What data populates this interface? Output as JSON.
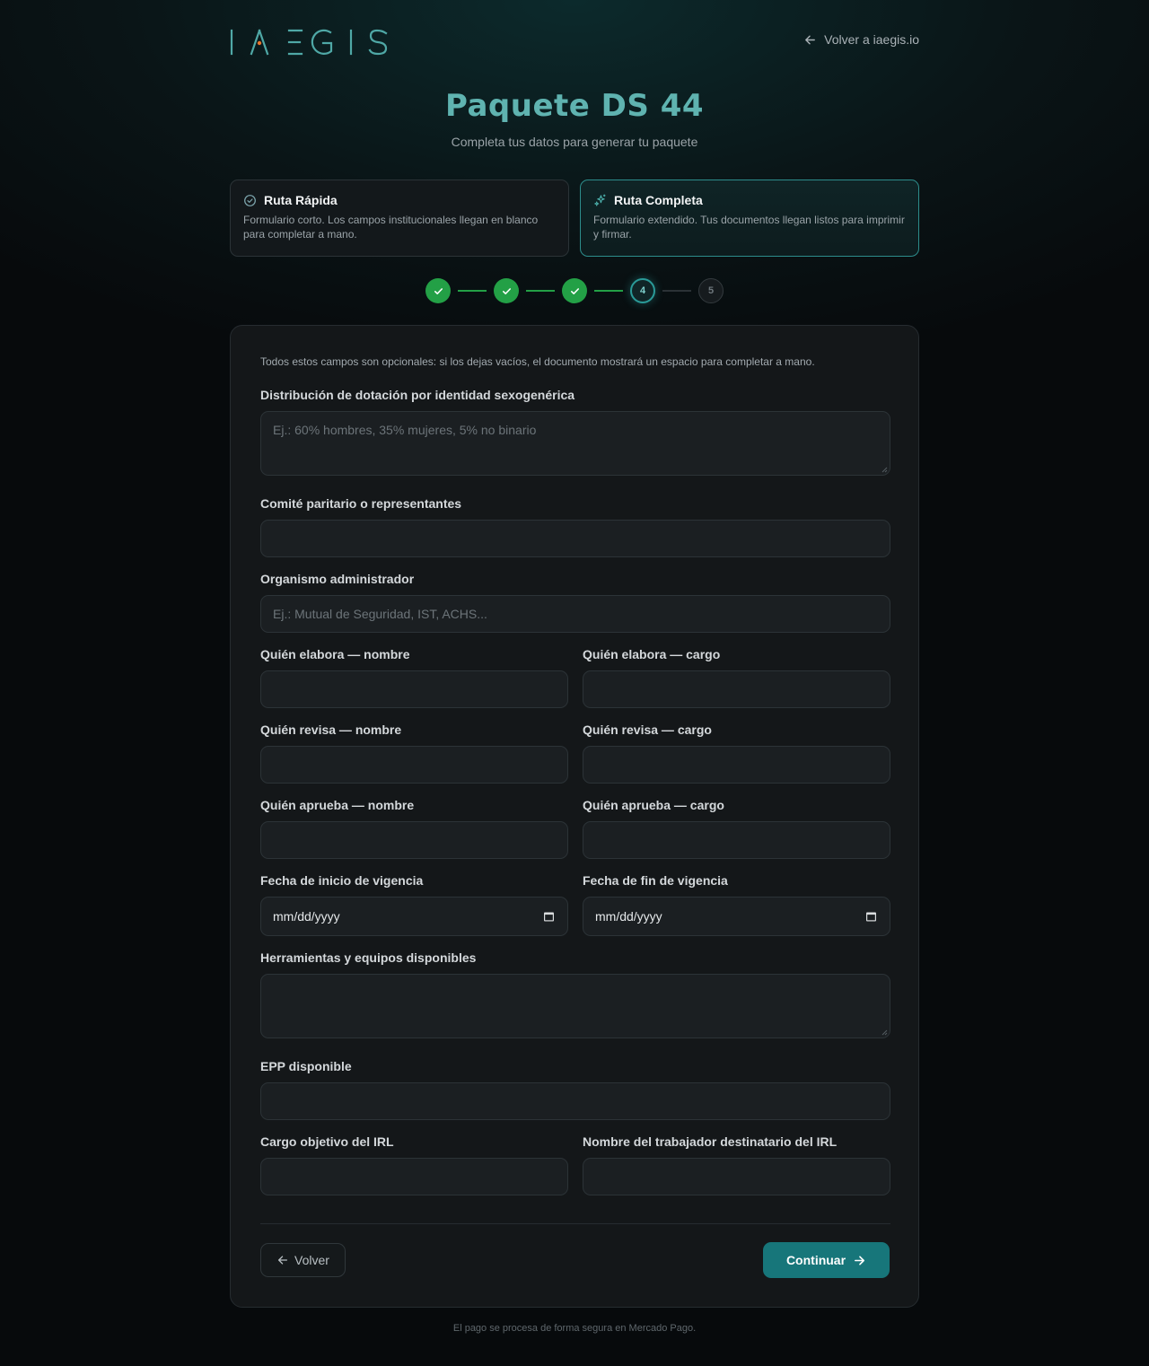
{
  "brand": {
    "logo_text": "IAEGIS",
    "accent_color": "#5fb3b0",
    "logo_dot_color": "#e8742a"
  },
  "header": {
    "back_link": "Volver a iaegis.io"
  },
  "page": {
    "title": "Paquete DS 44",
    "subtitle": "Completa tus datos para generar tu paquete"
  },
  "routes": [
    {
      "icon": "check-circle-icon",
      "title": "Ruta Rápida",
      "description": "Formulario corto. Los campos institucionales llegan en blanco para completar a mano.",
      "selected": false
    },
    {
      "icon": "sparkles-icon",
      "title": "Ruta Completa",
      "description": "Formulario extendido. Tus documentos llegan listos para imprimir y firmar.",
      "selected": true
    }
  ],
  "stepper": {
    "current": 4,
    "steps": [
      {
        "label": "1",
        "status": "done"
      },
      {
        "label": "2",
        "status": "done"
      },
      {
        "label": "3",
        "status": "done"
      },
      {
        "label": "4",
        "status": "current"
      },
      {
        "label": "5",
        "status": "pending"
      }
    ],
    "done_color": "#23a046"
  },
  "form": {
    "note": "Todos estos campos son opcionales: si los dejas vacíos, el documento mostrará un espacio para completar a mano.",
    "fields": {
      "distribucion": {
        "label": "Distribución de dotación por identidad sexogenérica",
        "placeholder": "Ej.: 60% hombres, 35% mujeres, 5% no binario",
        "value": ""
      },
      "comite": {
        "label": "Comité paritario o representantes",
        "placeholder": "",
        "value": ""
      },
      "organismo": {
        "label": "Organismo administrador",
        "placeholder": "Ej.: Mutual de Seguridad, IST, ACHS...",
        "value": ""
      },
      "elabora_nombre": {
        "label": "Quién elabora — nombre",
        "value": ""
      },
      "elabora_cargo": {
        "label": "Quién elabora — cargo",
        "value": ""
      },
      "revisa_nombre": {
        "label": "Quién revisa — nombre",
        "value": ""
      },
      "revisa_cargo": {
        "label": "Quién revisa — cargo",
        "value": ""
      },
      "aprueba_nombre": {
        "label": "Quién aprueba — nombre",
        "value": ""
      },
      "aprueba_cargo": {
        "label": "Quién aprueba — cargo",
        "value": ""
      },
      "fecha_inicio": {
        "label": "Fecha de inicio de vigencia",
        "value": "mm/dd/yyyy"
      },
      "fecha_fin": {
        "label": "Fecha de fin de vigencia",
        "value": "mm/dd/yyyy"
      },
      "herramientas": {
        "label": "Herramientas y equipos disponibles",
        "value": ""
      },
      "epp": {
        "label": "EPP disponible",
        "value": ""
      },
      "cargo_irl": {
        "label": "Cargo objetivo del IRL",
        "value": ""
      },
      "trabajador_irl": {
        "label": "Nombre del trabajador destinatario del IRL",
        "value": ""
      }
    },
    "back_button": "Volver",
    "continue_button": "Continuar",
    "continue_color": "#17767a"
  },
  "footer": {
    "text": "El pago se procesa de forma segura en Mercado Pago."
  }
}
